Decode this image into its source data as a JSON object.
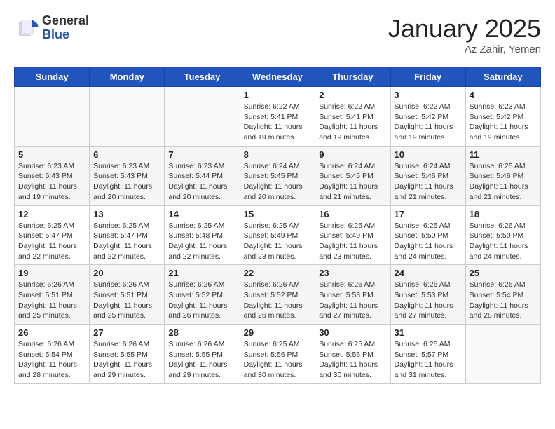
{
  "header": {
    "logo_general": "General",
    "logo_blue": "Blue",
    "month_title": "January 2025",
    "location": "Az Zahir, Yemen"
  },
  "weekdays": [
    "Sunday",
    "Monday",
    "Tuesday",
    "Wednesday",
    "Thursday",
    "Friday",
    "Saturday"
  ],
  "weeks": [
    [
      {
        "day": "",
        "info": ""
      },
      {
        "day": "",
        "info": ""
      },
      {
        "day": "",
        "info": ""
      },
      {
        "day": "1",
        "info": "Sunrise: 6:22 AM\nSunset: 5:41 PM\nDaylight: 11 hours and 19 minutes."
      },
      {
        "day": "2",
        "info": "Sunrise: 6:22 AM\nSunset: 5:41 PM\nDaylight: 11 hours and 19 minutes."
      },
      {
        "day": "3",
        "info": "Sunrise: 6:22 AM\nSunset: 5:42 PM\nDaylight: 11 hours and 19 minutes."
      },
      {
        "day": "4",
        "info": "Sunrise: 6:23 AM\nSunset: 5:42 PM\nDaylight: 11 hours and 19 minutes."
      }
    ],
    [
      {
        "day": "5",
        "info": "Sunrise: 6:23 AM\nSunset: 5:43 PM\nDaylight: 11 hours and 19 minutes."
      },
      {
        "day": "6",
        "info": "Sunrise: 6:23 AM\nSunset: 5:43 PM\nDaylight: 11 hours and 20 minutes."
      },
      {
        "day": "7",
        "info": "Sunrise: 6:23 AM\nSunset: 5:44 PM\nDaylight: 11 hours and 20 minutes."
      },
      {
        "day": "8",
        "info": "Sunrise: 6:24 AM\nSunset: 5:45 PM\nDaylight: 11 hours and 20 minutes."
      },
      {
        "day": "9",
        "info": "Sunrise: 6:24 AM\nSunset: 5:45 PM\nDaylight: 11 hours and 21 minutes."
      },
      {
        "day": "10",
        "info": "Sunrise: 6:24 AM\nSunset: 5:46 PM\nDaylight: 11 hours and 21 minutes."
      },
      {
        "day": "11",
        "info": "Sunrise: 6:25 AM\nSunset: 5:46 PM\nDaylight: 11 hours and 21 minutes."
      }
    ],
    [
      {
        "day": "12",
        "info": "Sunrise: 6:25 AM\nSunset: 5:47 PM\nDaylight: 11 hours and 22 minutes."
      },
      {
        "day": "13",
        "info": "Sunrise: 6:25 AM\nSunset: 5:47 PM\nDaylight: 11 hours and 22 minutes."
      },
      {
        "day": "14",
        "info": "Sunrise: 6:25 AM\nSunset: 5:48 PM\nDaylight: 11 hours and 22 minutes."
      },
      {
        "day": "15",
        "info": "Sunrise: 6:25 AM\nSunset: 5:49 PM\nDaylight: 11 hours and 23 minutes."
      },
      {
        "day": "16",
        "info": "Sunrise: 6:25 AM\nSunset: 5:49 PM\nDaylight: 11 hours and 23 minutes."
      },
      {
        "day": "17",
        "info": "Sunrise: 6:25 AM\nSunset: 5:50 PM\nDaylight: 11 hours and 24 minutes."
      },
      {
        "day": "18",
        "info": "Sunrise: 6:26 AM\nSunset: 5:50 PM\nDaylight: 11 hours and 24 minutes."
      }
    ],
    [
      {
        "day": "19",
        "info": "Sunrise: 6:26 AM\nSunset: 5:51 PM\nDaylight: 11 hours and 25 minutes."
      },
      {
        "day": "20",
        "info": "Sunrise: 6:26 AM\nSunset: 5:51 PM\nDaylight: 11 hours and 25 minutes."
      },
      {
        "day": "21",
        "info": "Sunrise: 6:26 AM\nSunset: 5:52 PM\nDaylight: 11 hours and 26 minutes."
      },
      {
        "day": "22",
        "info": "Sunrise: 6:26 AM\nSunset: 5:52 PM\nDaylight: 11 hours and 26 minutes."
      },
      {
        "day": "23",
        "info": "Sunrise: 6:26 AM\nSunset: 5:53 PM\nDaylight: 11 hours and 27 minutes."
      },
      {
        "day": "24",
        "info": "Sunrise: 6:26 AM\nSunset: 5:53 PM\nDaylight: 11 hours and 27 minutes."
      },
      {
        "day": "25",
        "info": "Sunrise: 6:26 AM\nSunset: 5:54 PM\nDaylight: 11 hours and 28 minutes."
      }
    ],
    [
      {
        "day": "26",
        "info": "Sunrise: 6:26 AM\nSunset: 5:54 PM\nDaylight: 11 hours and 28 minutes."
      },
      {
        "day": "27",
        "info": "Sunrise: 6:26 AM\nSunset: 5:55 PM\nDaylight: 11 hours and 29 minutes."
      },
      {
        "day": "28",
        "info": "Sunrise: 6:26 AM\nSunset: 5:55 PM\nDaylight: 11 hours and 29 minutes."
      },
      {
        "day": "29",
        "info": "Sunrise: 6:25 AM\nSunset: 5:56 PM\nDaylight: 11 hours and 30 minutes."
      },
      {
        "day": "30",
        "info": "Sunrise: 6:25 AM\nSunset: 5:56 PM\nDaylight: 11 hours and 30 minutes."
      },
      {
        "day": "31",
        "info": "Sunrise: 6:25 AM\nSunset: 5:57 PM\nDaylight: 11 hours and 31 minutes."
      },
      {
        "day": "",
        "info": ""
      }
    ]
  ]
}
